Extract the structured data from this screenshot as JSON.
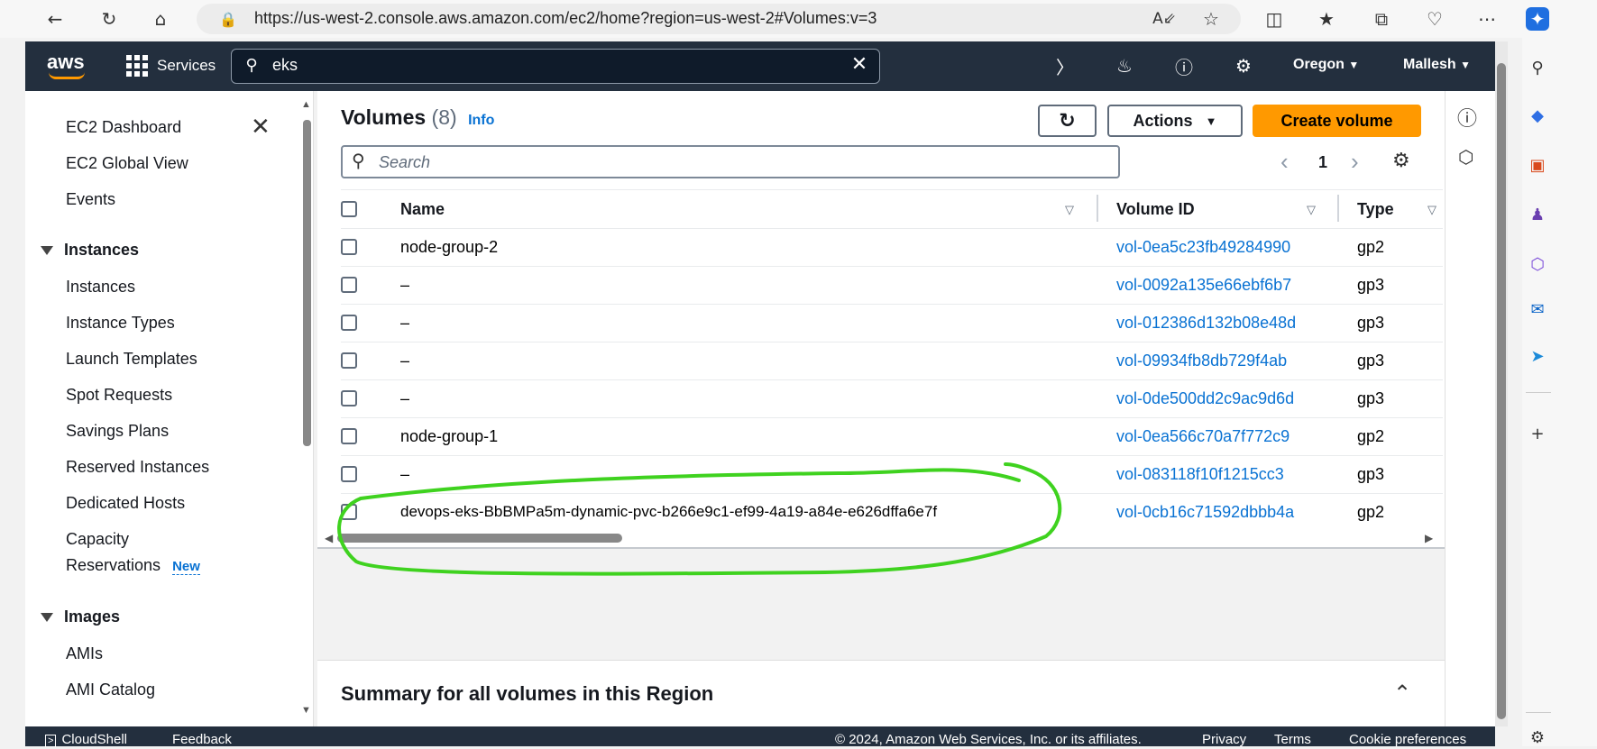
{
  "browser": {
    "url": "https://us-west-2.console.aws.amazon.com/ec2/home?region=us-west-2#Volumes:v=3",
    "icons": [
      "back-icon",
      "refresh-icon",
      "home-icon",
      "lock-icon",
      "read-aloud-icon",
      "favorite-star-icon",
      "split-screen-icon",
      "favorites-icon",
      "collections-icon",
      "heart-monitor-icon",
      "more-icon",
      "copilot-icon"
    ]
  },
  "aws_nav": {
    "logo": "aws",
    "services_label": "Services",
    "search_value": "eks",
    "region_label": "Oregon",
    "user_label": "Mallesh"
  },
  "left_nav": {
    "top_items": [
      "EC2 Dashboard",
      "EC2 Global View",
      "Events"
    ],
    "sections": [
      {
        "heading": "Instances",
        "items": [
          "Instances",
          "Instance Types",
          "Launch Templates",
          "Spot Requests",
          "Savings Plans",
          "Reserved Instances",
          "Dedicated Hosts",
          "Capacity",
          "Reservations"
        ]
      },
      {
        "heading": "Images",
        "items": [
          "AMIs",
          "AMI Catalog"
        ]
      }
    ],
    "new_badge": "New"
  },
  "volumes": {
    "title": "Volumes",
    "count": "(8)",
    "info": "Info",
    "actions_label": "Actions",
    "create_label": "Create volume",
    "search_placeholder": "Search",
    "page_number": "1",
    "columns": [
      "Name",
      "Volume ID",
      "Type"
    ],
    "rows": [
      {
        "name": "node-group-2",
        "volume_id": "vol-0ea5c23fb49284990",
        "type": "gp2"
      },
      {
        "name": "–",
        "volume_id": "vol-0092a135e66ebf6b7",
        "type": "gp3"
      },
      {
        "name": "–",
        "volume_id": "vol-012386d132b08e48d",
        "type": "gp3"
      },
      {
        "name": "–",
        "volume_id": "vol-09934fb8db729f4ab",
        "type": "gp3"
      },
      {
        "name": "–",
        "volume_id": "vol-0de500dd2c9ac9d6d",
        "type": "gp3"
      },
      {
        "name": "node-group-1",
        "volume_id": "vol-0ea566c70a7f772c9",
        "type": "gp2"
      },
      {
        "name": "–",
        "volume_id": "vol-083118f10f1215cc3",
        "type": "gp3"
      },
      {
        "name": "devops-eks-BbBMPa5m-dynamic-pvc-b266e9c1-ef99-4a19-a84e-e626dffa6e7f",
        "volume_id": "vol-0cb16c71592dbbb4a",
        "type": "gp2"
      }
    ],
    "summary_title": "Summary for all volumes in this Region"
  },
  "footer": {
    "cloudshell": "CloudShell",
    "feedback": "Feedback",
    "copyright": "© 2024, Amazon Web Services, Inc. or its affiliates.",
    "privacy": "Privacy",
    "terms": "Terms",
    "cookie": "Cookie preferences"
  },
  "colors": {
    "nav_bg": "#232f3e",
    "accent": "#ff9900",
    "link": "#0972d3",
    "annotation": "#3fd21f"
  }
}
